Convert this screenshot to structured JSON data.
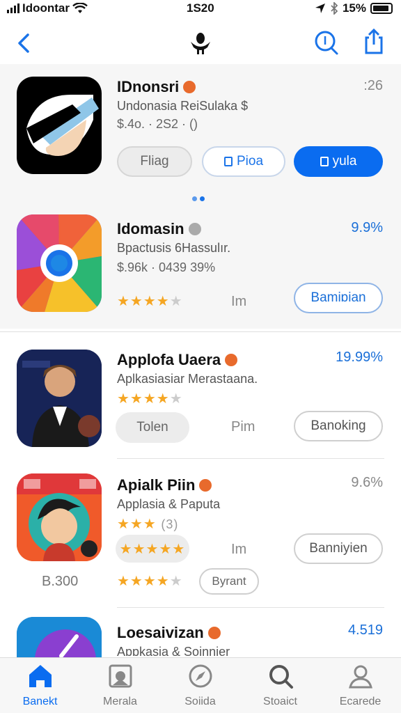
{
  "status_bar": {
    "carrier": "Idoontar",
    "time": "1S20",
    "battery": "15%"
  },
  "nav": {
    "back_icon": "chevron-left-icon",
    "center_icon": "app-logo-icon",
    "search_icon": "search-icon",
    "share_icon": "share-icon"
  },
  "apps": [
    {
      "name": "IDnonsri",
      "subtitle": "Undonasia  ReiSulaka $",
      "meta": "$.4o. · 2S2 · ()",
      "right_value": ":26",
      "buttons": {
        "flag": "Fliag",
        "secondary": "Pioa",
        "primary": "yula"
      }
    },
    {
      "name": "Idomasin",
      "subtitle": "Bpactusis 6Hassulır.",
      "meta": "$.96k · 0439 39%",
      "right_value": "9.9%",
      "rating": 4,
      "mid": "Im",
      "button": "Bamiɒian"
    },
    {
      "name": "Applofa Uaera",
      "subtitle": "Aplkasiasiar Merastaana.",
      "right_value": "19.99%",
      "rating": 4,
      "tag": "Tolen",
      "mid": "Pim",
      "button": "Banoking"
    },
    {
      "name": "Apialk Piin",
      "subtitle": "Applasia & Paputa",
      "rating_text": "(3)",
      "rating": 3,
      "right_value": "9.6%",
      "mid": "Im",
      "button": "Banniyien",
      "price_left": "B.300",
      "rating2": 4,
      "tag2": "Byrant"
    },
    {
      "name": "Loesaivizan",
      "subtitle": "Appkasia & Soinnier",
      "right_value": "4.519"
    }
  ],
  "tabs": [
    {
      "label": "Banekt",
      "icon": "home-icon",
      "active": true
    },
    {
      "label": "Merala",
      "icon": "gallery-icon"
    },
    {
      "label": "Soiida",
      "icon": "compass-icon"
    },
    {
      "label": "Stoaict",
      "icon": "search-icon"
    },
    {
      "label": "Ecarede",
      "icon": "person-icon"
    }
  ],
  "colors": {
    "accent": "#0a6cf0",
    "star": "#f5a623",
    "badge": "#e86a2c"
  }
}
